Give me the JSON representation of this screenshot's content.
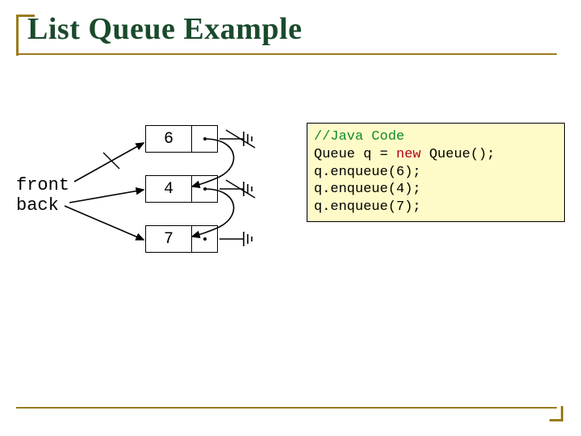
{
  "title": "List Queue Example",
  "labels": {
    "front": "front",
    "back": "back"
  },
  "nodes": {
    "n1": "6",
    "n2": "4",
    "n3": "7"
  },
  "code": {
    "comment": "//Java Code",
    "line2_pre": "Queue q = ",
    "line2_kw": "new",
    "line2_post": " Queue();",
    "line3": "q.enqueue(6);",
    "line4": "q.enqueue(4);",
    "line5": "q.enqueue(7);"
  }
}
